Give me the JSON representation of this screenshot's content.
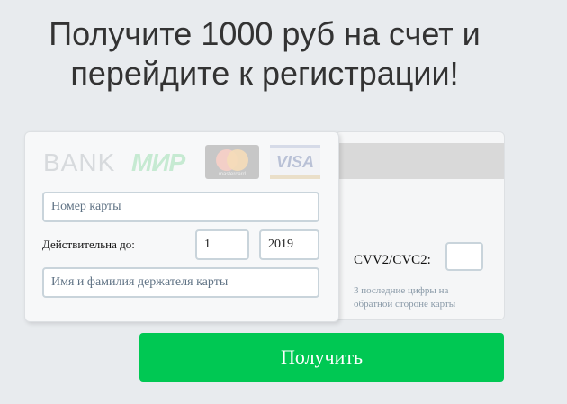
{
  "headline": "Получите 1000 руб на счет и перейдите к регистрации!",
  "card_front": {
    "logos": {
      "bank": "BANK",
      "mir": "МИР",
      "mastercard": "mastercard",
      "visa": "VISA"
    },
    "card_number": {
      "placeholder": "Номер карты",
      "value": ""
    },
    "expiry": {
      "label": "Действительна до:",
      "month": "1",
      "year": "2019"
    },
    "holder_name": {
      "placeholder": "Имя и фамилия держателя карты",
      "value": ""
    }
  },
  "card_back": {
    "cvv_label": "CVV2/CVC2:",
    "cvv_value": "",
    "cvv_hint": "3 последние цифры на обратной стороне карты"
  },
  "submit_label": "Получить",
  "colors": {
    "background": "#e8ebee",
    "button": "#00c853",
    "field_border": "#c9d4db"
  }
}
